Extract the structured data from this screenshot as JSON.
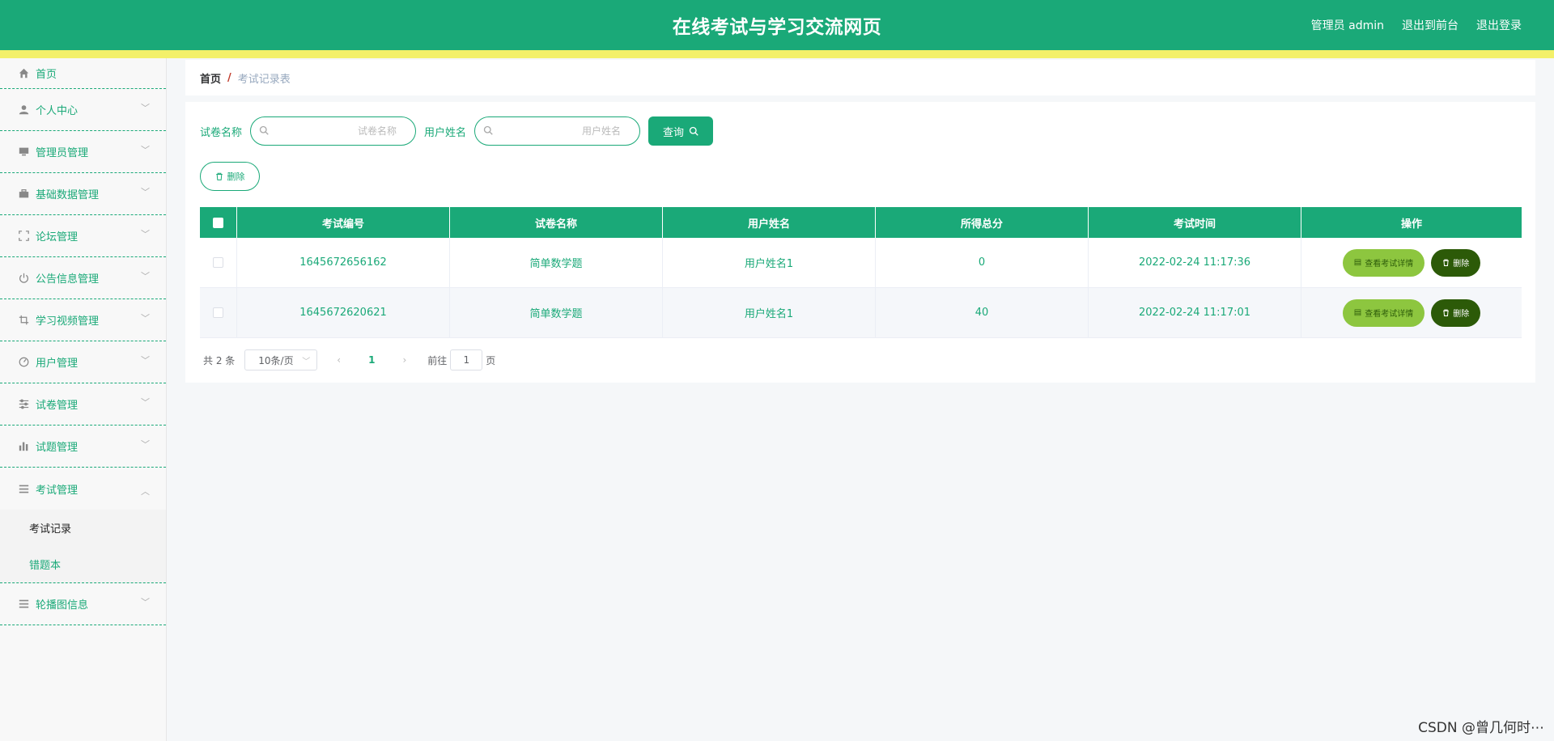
{
  "header": {
    "title": "在线考试与学习交流网页",
    "admin_label": "管理员 admin",
    "back_front": "退出到前台",
    "logout": "退出登录",
    "bg_color": "#1aa978",
    "bar_color": "#f3f06a"
  },
  "sidebar": {
    "items": [
      {
        "label": "首页",
        "icon": "home-icon"
      },
      {
        "label": "个人中心",
        "icon": "user-icon"
      },
      {
        "label": "管理员管理",
        "icon": "monitor-icon"
      },
      {
        "label": "基础数据管理",
        "icon": "briefcase-icon"
      },
      {
        "label": "论坛管理",
        "icon": "fullscreen-icon"
      },
      {
        "label": "公告信息管理",
        "icon": "power-icon"
      },
      {
        "label": "学习视频管理",
        "icon": "crop-icon"
      },
      {
        "label": "用户管理",
        "icon": "odometer-icon"
      },
      {
        "label": "试卷管理",
        "icon": "sliders-icon"
      },
      {
        "label": "试题管理",
        "icon": "bar-chart-icon"
      },
      {
        "label": "考试管理",
        "icon": "menu-icon"
      },
      {
        "label": "轮播图信息",
        "icon": "menu-icon"
      }
    ],
    "exam_sub": [
      {
        "label": "考试记录"
      },
      {
        "label": "错题本"
      }
    ]
  },
  "breadcrumb": {
    "home": "首页",
    "separator": "/",
    "current": "考试记录表"
  },
  "search": {
    "paper_label": "试卷名称",
    "paper_placeholder": "试卷名称",
    "user_label": "用户姓名",
    "user_placeholder": "用户姓名",
    "query_button": "查询"
  },
  "actions": {
    "delete_button": "删除"
  },
  "table": {
    "headers": [
      "考试编号",
      "试卷名称",
      "用户姓名",
      "所得总分",
      "考试时间",
      "操作"
    ],
    "rows": [
      {
        "id": "1645672656162",
        "paper": "简单数学题",
        "user": "用户姓名1",
        "score": "0",
        "time": "2022-02-24 11:17:36"
      },
      {
        "id": "1645672620621",
        "paper": "简单数学题",
        "user": "用户姓名1",
        "score": "40",
        "time": "2022-02-24 11:17:01"
      }
    ],
    "detail_button": "查看考试详情",
    "row_delete_button": "删除"
  },
  "pagination": {
    "total": "共 2 条",
    "page_size": "10条/页",
    "current_page": "1",
    "goto_label": "前往",
    "goto_value": "1",
    "page_suffix": "页"
  },
  "watermark": "CSDN @曾几何时⋯"
}
